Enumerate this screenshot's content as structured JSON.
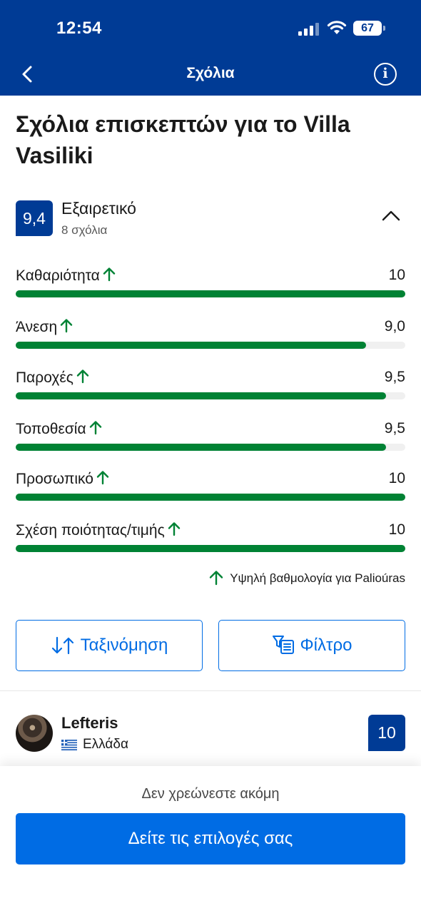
{
  "status_bar": {
    "time": "12:54",
    "battery": "67"
  },
  "nav": {
    "title": "Σχόλια"
  },
  "page_title": "Σχόλια επισκεπτών για το Villa Vasiliki",
  "summary": {
    "score": "9,4",
    "label": "Εξαιρετικό",
    "count": "8 σχόλια"
  },
  "categories": [
    {
      "label": "Καθαριότητα",
      "score": "10",
      "fraction": 1.0
    },
    {
      "label": "Άνεση",
      "score": "9,0",
      "fraction": 0.9
    },
    {
      "label": "Παροχές",
      "score": "9,5",
      "fraction": 0.95
    },
    {
      "label": "Τοποθεσία",
      "score": "9,5",
      "fraction": 0.95
    },
    {
      "label": "Προσωπικό",
      "score": "10",
      "fraction": 1.0
    },
    {
      "label": "Σχέση ποιότητας/τιμής",
      "score": "10",
      "fraction": 1.0
    }
  ],
  "high_score_note": "Υψηλή βαθμολογία για Palioúras",
  "buttons": {
    "sort": "Ταξινόμηση",
    "filter": "Φίλτρο"
  },
  "review": {
    "name": "Lefteris",
    "country": "Ελλάδα",
    "score": "10"
  },
  "footer": {
    "note": "Δεν χρεώνεστε ακόμη",
    "cta": "Δείτε τις επιλογές σας"
  },
  "colors": {
    "brand_dark": "#003b95",
    "brand_blue": "#006ce4",
    "positive_green": "#008234"
  }
}
